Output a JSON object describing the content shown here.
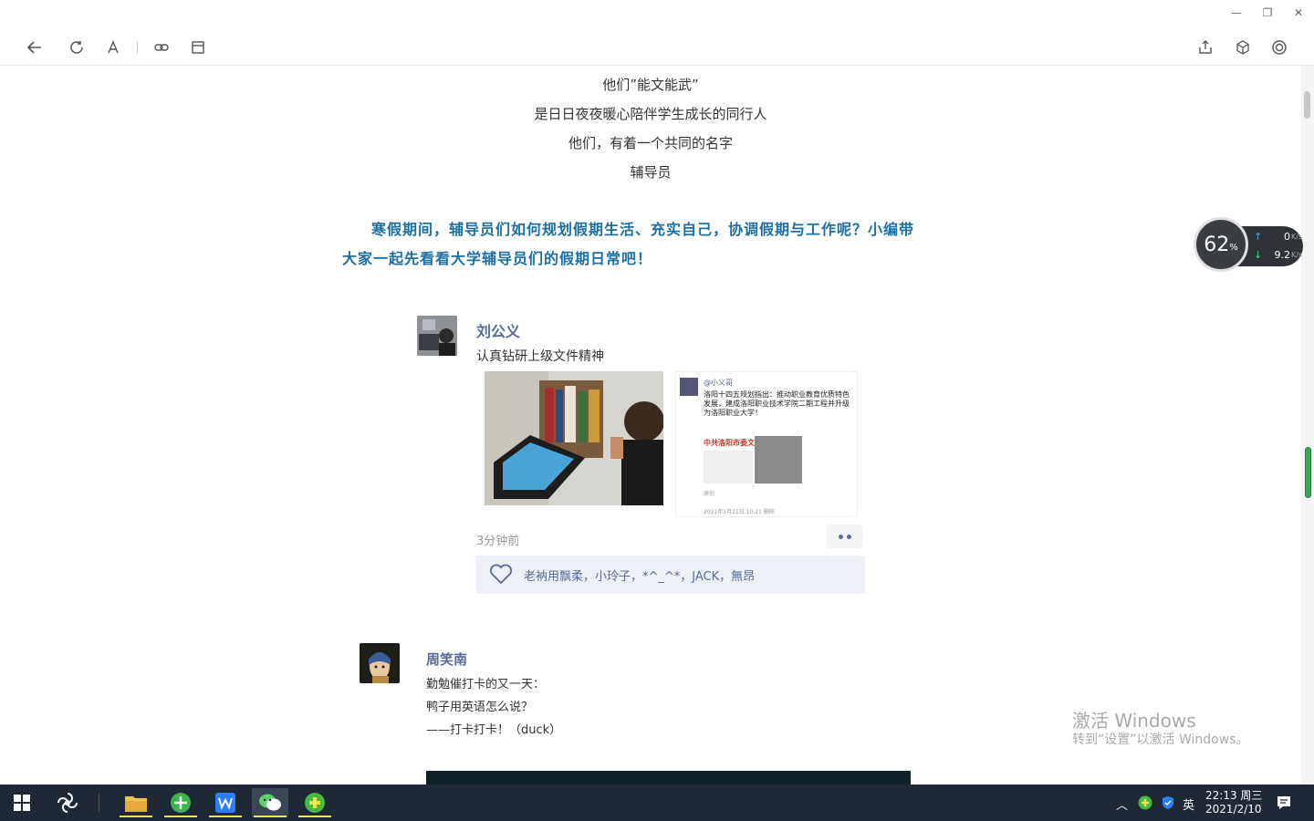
{
  "window": {
    "minimize_glyph": "—",
    "restore_glyph": "❐",
    "close_glyph": "✕"
  },
  "toolbar": {
    "icons": [
      "back-icon",
      "refresh-icon",
      "font-icon",
      "link-icon",
      "window-icon",
      "share-icon",
      "cube-icon",
      "target-icon"
    ]
  },
  "article": {
    "lines": [
      "他们”能文能武”",
      "是日日夜夜暖心陪伴学生成长的同行人",
      "他们，有着一个共同的名字",
      "辅导员"
    ],
    "highlight_line1": "寒假期间，辅导员们如何规划假期生活、充实自己，协调假期与工作呢？小编带",
    "highlight_line2": "大家一起先看看大学辅导员们的假期日常吧！"
  },
  "post1": {
    "name": "刘公义",
    "text": "认真钻研上级文件精神",
    "time": "3分钟前",
    "likes": "老衲用飘柔，小玲子，*^_^*，JACK，無昂",
    "screenshot_user": "@小义哥",
    "screenshot_text": "洛阳十四五规划指出：推动职业教育优质特色发展，建成洛阳职业技术学院二期工程并升级为洛阳职业大学！",
    "screenshot_doc_title": "中共洛阳市委文件",
    "screenshot_time": "2021年1月21日 10:21  删除",
    "screenshot_misc": "原创"
  },
  "post2": {
    "name": "周笑南",
    "lines": [
      "勤勉催打卡的又一天：",
      "鸭子用英语怎么说？",
      "——打卡打卡！（duck）"
    ]
  },
  "speed": {
    "percent": "62",
    "percent_unit": "%",
    "up": "0",
    "down": "9.2",
    "unit": "K/s"
  },
  "watermark": {
    "line1": "激活 Windows",
    "line2": "转到“设置”以激活 Windows。"
  },
  "taskbar": {
    "ime": "英",
    "time": "22:13 周三",
    "date": "2021/2/10"
  }
}
